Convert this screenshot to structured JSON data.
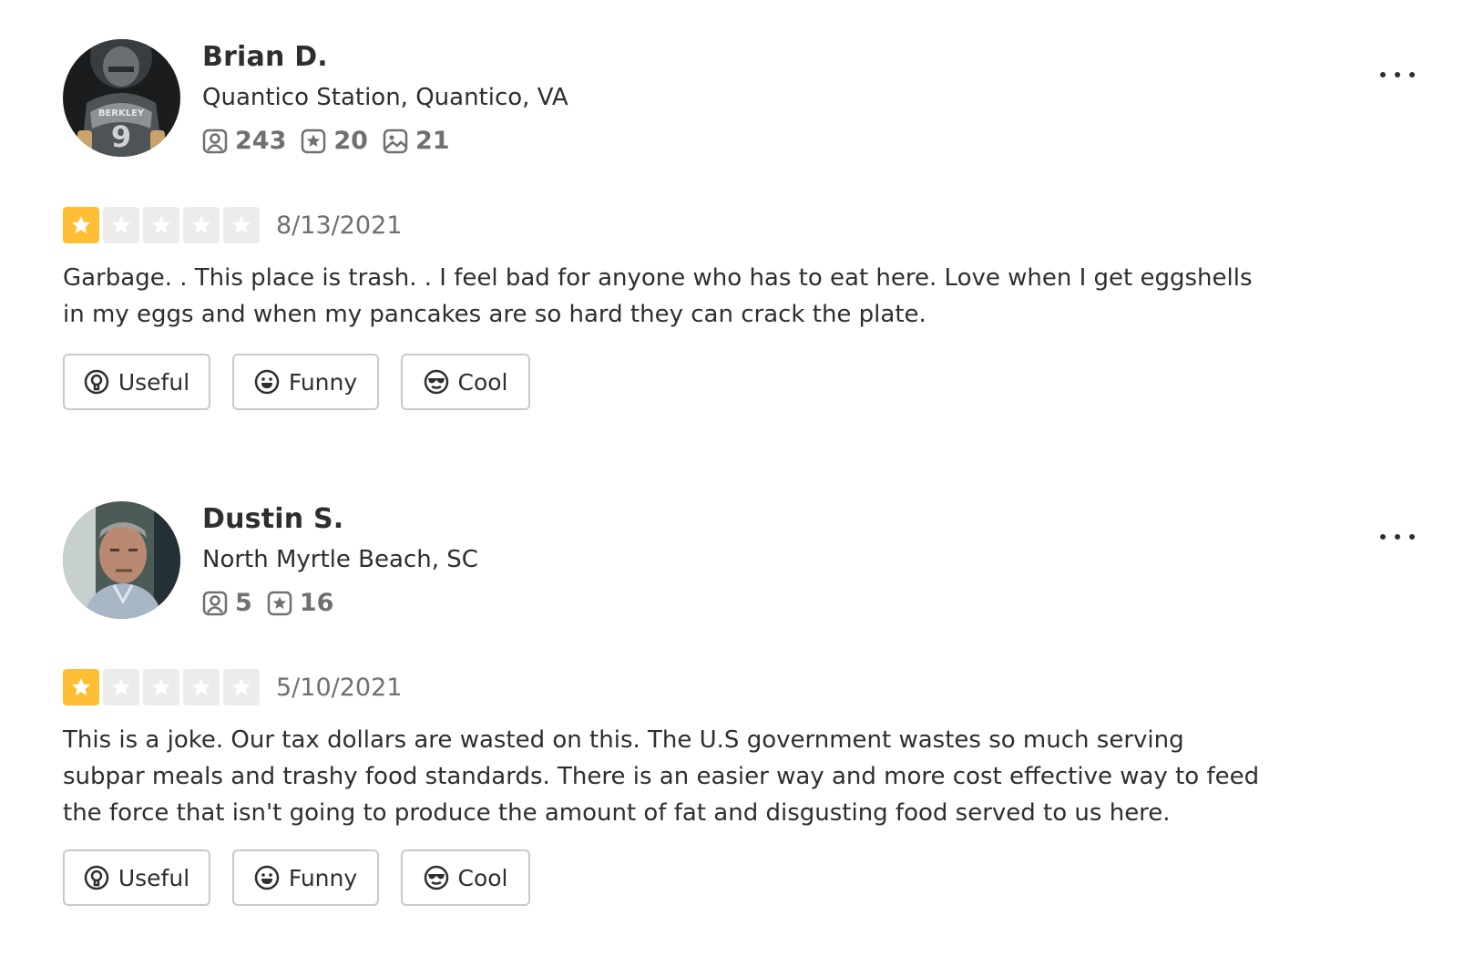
{
  "reviews": [
    {
      "user": {
        "name": "Brian D.",
        "location": "Quantico Station, Quantico, VA",
        "avatar_icon": "football-player-avatar",
        "stats": [
          {
            "icon": "friends-icon",
            "value": "243"
          },
          {
            "icon": "reviews-icon",
            "value": "20"
          },
          {
            "icon": "photos-icon",
            "value": "21"
          }
        ]
      },
      "rating": 1,
      "rating_max": 5,
      "date": "8/13/2021",
      "text": "Garbage. . This place is trash. . I feel bad for anyone who has to eat here. Love when I get eggshells in my eggs and when my pancakes are so hard they can crack the plate.",
      "actions": {
        "useful": "Useful",
        "funny": "Funny",
        "cool": "Cool"
      }
    },
    {
      "user": {
        "name": "Dustin S.",
        "location": "North Myrtle Beach, SC",
        "avatar_icon": "man-portrait-avatar",
        "stats": [
          {
            "icon": "friends-icon",
            "value": "5"
          },
          {
            "icon": "reviews-icon",
            "value": "16"
          }
        ]
      },
      "rating": 1,
      "rating_max": 5,
      "date": "5/10/2021",
      "text": "This is a joke. Our tax dollars are wasted on this. The U.S government wastes so much serving subpar meals and trashy food standards. There is an easier way and more cost effective way to feed the force that isn't going to produce the amount of fat and disgusting food served to us here.",
      "actions": {
        "useful": "Useful",
        "funny": "Funny",
        "cool": "Cool"
      }
    }
  ],
  "colors": {
    "star_active": "#ffbf35",
    "star_inactive": "#ececec",
    "text": "#2d2e2f",
    "muted": "#6e7072",
    "button_border": "#c8c9ca"
  }
}
